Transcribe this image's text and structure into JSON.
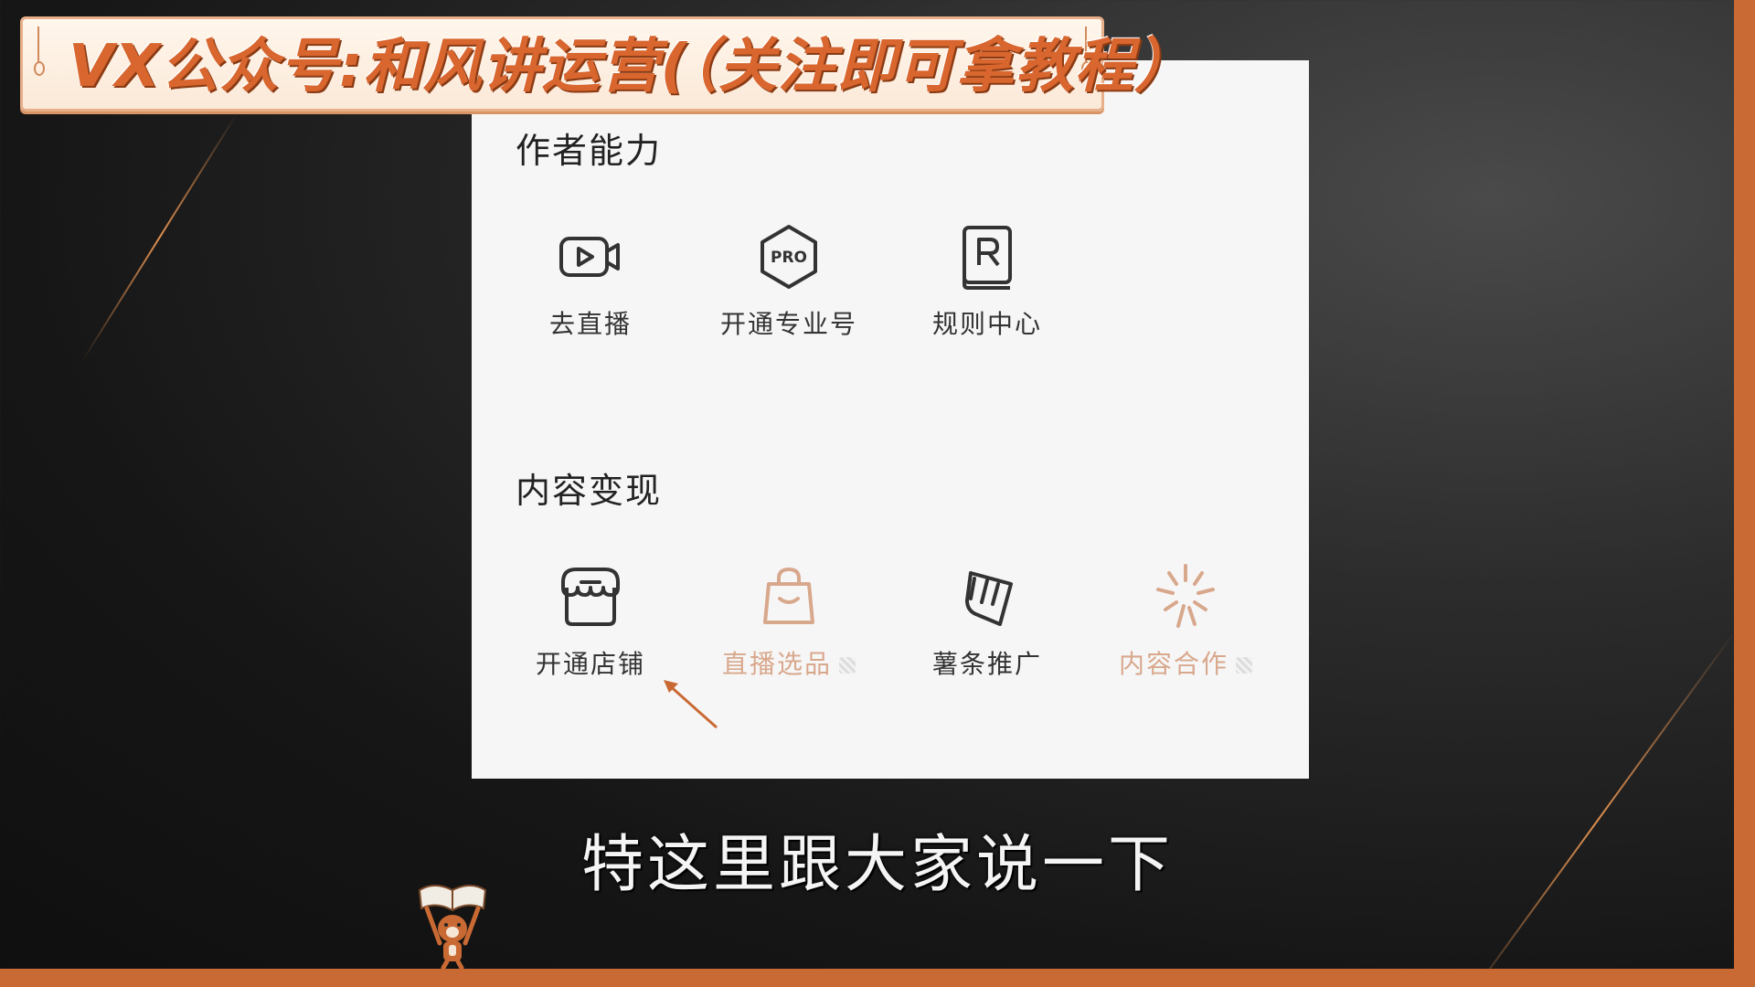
{
  "banner": {
    "text": "VX公众号:和风讲运营(（关注即可拿教程）"
  },
  "sections": [
    {
      "title": "作者能力",
      "items": [
        {
          "label": "去直播",
          "icon": "video-camera-icon"
        },
        {
          "label": "开通专业号",
          "icon": "pro-badge-icon"
        },
        {
          "label": "规则中心",
          "icon": "rule-book-icon"
        }
      ]
    },
    {
      "title": "内容变现",
      "items": [
        {
          "label": "开通店铺",
          "icon": "store-icon"
        },
        {
          "label": "直播选品",
          "icon": "shopping-bag-icon",
          "faded": true
        },
        {
          "label": "薯条推广",
          "icon": "fries-promo-icon"
        },
        {
          "label": "内容合作",
          "icon": "sparkle-icon",
          "faded": true
        }
      ]
    }
  ],
  "subtitle": "特这里跟大家说一下",
  "colors": {
    "accent": "#c96a34",
    "banner_text": "#d8662e",
    "panel_bg": "#f7f6f7",
    "icon_stroke": "#333333",
    "faded": "#d8a88c"
  }
}
